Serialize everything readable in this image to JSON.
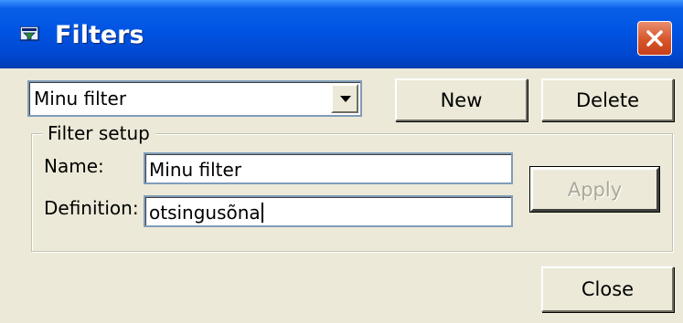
{
  "window": {
    "title": "Filters",
    "title_icon": "filter-window-icon",
    "close_icon": "close-icon",
    "accent": "#0054e3",
    "close_color": "#d7552a"
  },
  "toolbar": {
    "filter_select": {
      "value": "Minu filter",
      "arrow_icon": "dropdown-arrow-icon"
    },
    "new_label": "New",
    "delete_label": "Delete"
  },
  "filter_setup": {
    "legend": "Filter setup",
    "name_label": "Name:",
    "name_value": "Minu filter",
    "definition_label": "Definition:",
    "definition_value": "otsingusõna",
    "apply_label": "Apply",
    "apply_disabled": true
  },
  "footer": {
    "close_label": "Close"
  }
}
